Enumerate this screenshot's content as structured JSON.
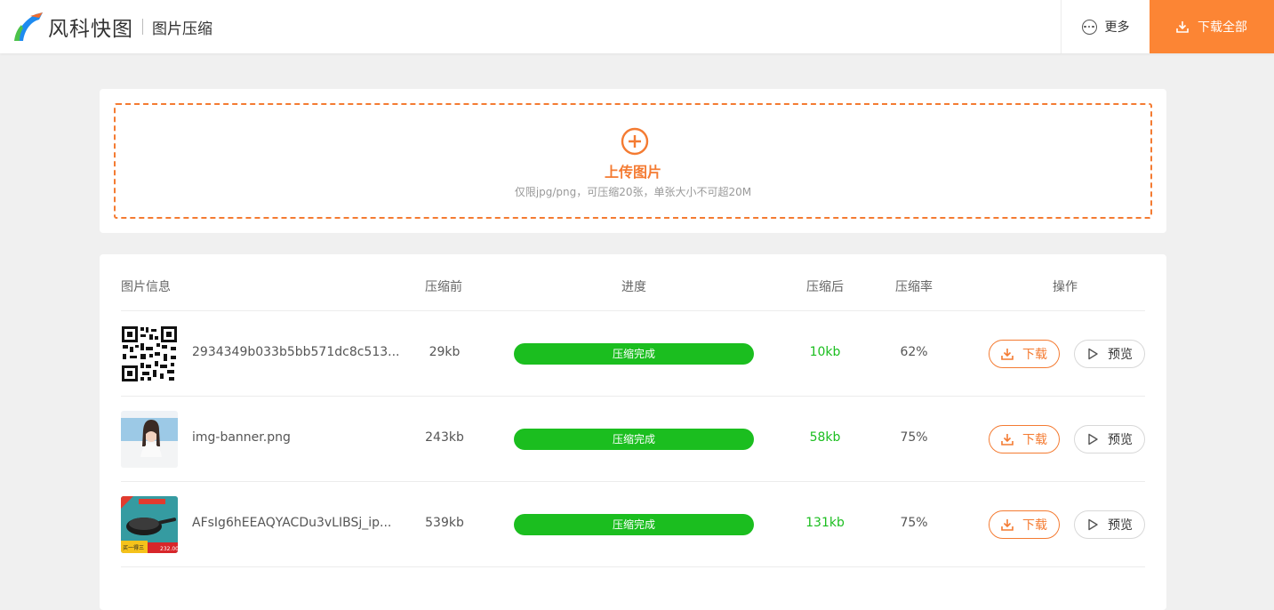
{
  "header": {
    "logo_text": "风科快图",
    "subtitle": "图片压缩",
    "more_label": "更多",
    "download_all_label": "下载全部"
  },
  "upload": {
    "title": "上传图片",
    "hint": "仅限jpg/png，可压缩20张，单张大小不可超20M"
  },
  "table": {
    "headers": {
      "info": "图片信息",
      "before": "压缩前",
      "progress": "进度",
      "after": "压缩后",
      "rate": "压缩率",
      "action": "操作"
    },
    "rows": [
      {
        "name": "2934349b033b5bb571dc8c513...",
        "before": "29kb",
        "status": "压缩完成",
        "progress": 1.0,
        "after": "10kb",
        "rate": "62%",
        "download": "下载",
        "preview": "预览",
        "thumb": "qr-code"
      },
      {
        "name": "img-banner.png",
        "before": "243kb",
        "status": "压缩完成",
        "progress": 1.0,
        "after": "58kb",
        "rate": "75%",
        "download": "下载",
        "preview": "预览",
        "thumb": "portrait"
      },
      {
        "name": "AFsIg6hEEAQYACDu3vLIBSj_ip...",
        "before": "539kb",
        "status": "压缩完成",
        "progress": 1.0,
        "after": "131kb",
        "rate": "75%",
        "download": "下载",
        "preview": "预览",
        "thumb": "pan-product"
      }
    ]
  },
  "colors": {
    "accent": "#fc8534",
    "upload_border": "#f47b32",
    "success": "#1bbe1f"
  }
}
